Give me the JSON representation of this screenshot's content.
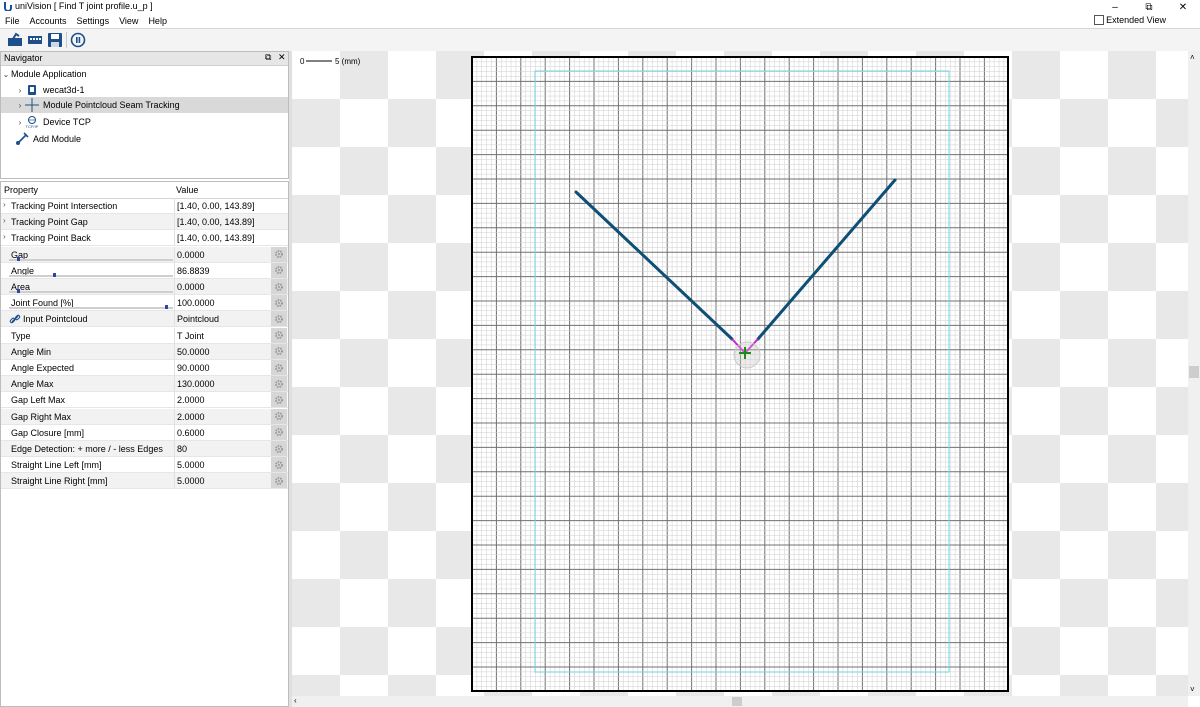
{
  "window": {
    "title": "uniVision [ Find T joint profile.u_p ]",
    "controls": [
      "–",
      "⧉",
      "✕"
    ]
  },
  "menu": {
    "items": [
      "File",
      "Accounts",
      "Settings",
      "View",
      "Help"
    ],
    "extended_view": {
      "label": "Extended View",
      "checked": false
    }
  },
  "toolbar": {
    "buttons": [
      {
        "name": "open-icon"
      },
      {
        "name": "camera-icon"
      },
      {
        "name": "save-icon"
      },
      {
        "name": "run-icon"
      }
    ]
  },
  "navigator": {
    "title": "Navigator",
    "root": "Module Application",
    "items": [
      {
        "label": "wecat3d-1",
        "icon": "sensor-icon"
      },
      {
        "label": "Module Pointcloud Seam Tracking",
        "icon": "crosshair-icon",
        "selected": true
      },
      {
        "label": "Device TCP",
        "icon": "network-icon",
        "icon_text": "TCP/IP"
      },
      {
        "label": "Add Module",
        "icon": "add-module-icon"
      }
    ]
  },
  "properties": {
    "header": {
      "property": "Property",
      "value": "Value"
    },
    "rows": [
      {
        "name": "Tracking Point Intersection",
        "value": "[1.40, 0.00, 143.89]",
        "expandable": true
      },
      {
        "name": "Tracking Point Gap",
        "value": "[1.40, 0.00, 143.89]",
        "expandable": true
      },
      {
        "name": "Tracking Point Back",
        "value": "[1.40, 0.00, 143.89]",
        "expandable": true
      },
      {
        "name": "Gap",
        "value": "0.0000",
        "slider": 0.05
      },
      {
        "name": "Angle",
        "value": "86.8839",
        "slider": 0.27
      },
      {
        "name": "Area",
        "value": "0.0000",
        "slider": 0.05
      },
      {
        "name": "Joint Found [%]",
        "value": "100.0000",
        "slider": 0.95
      },
      {
        "name": "Input Pointcloud",
        "value": "Pointcloud",
        "link": true
      },
      {
        "name": "Type",
        "value": "T Joint"
      },
      {
        "name": "Angle Min",
        "value": "50.0000"
      },
      {
        "name": "Angle Expected",
        "value": "90.0000"
      },
      {
        "name": "Angle Max",
        "value": "130.0000"
      },
      {
        "name": "Gap Left Max",
        "value": "2.0000"
      },
      {
        "name": "Gap Right Max",
        "value": "2.0000"
      },
      {
        "name": "Gap Closure [mm]",
        "value": "0.6000"
      },
      {
        "name": "Edge Detection: + more / - less Edges",
        "value": "80"
      },
      {
        "name": "Straight Line Left [mm]",
        "value": "5.0000"
      },
      {
        "name": "Straight Line Right [mm]",
        "value": "5.0000"
      }
    ]
  },
  "viewer": {
    "scale_start": "0",
    "scale_label": "5 (mm)",
    "colors": {
      "grid_line": "#9a9a9a",
      "roi": "#6fd6e0",
      "profile": "#0e4f75",
      "joint": "#cc22cc",
      "tracking_point": "#1c8c1c"
    }
  }
}
